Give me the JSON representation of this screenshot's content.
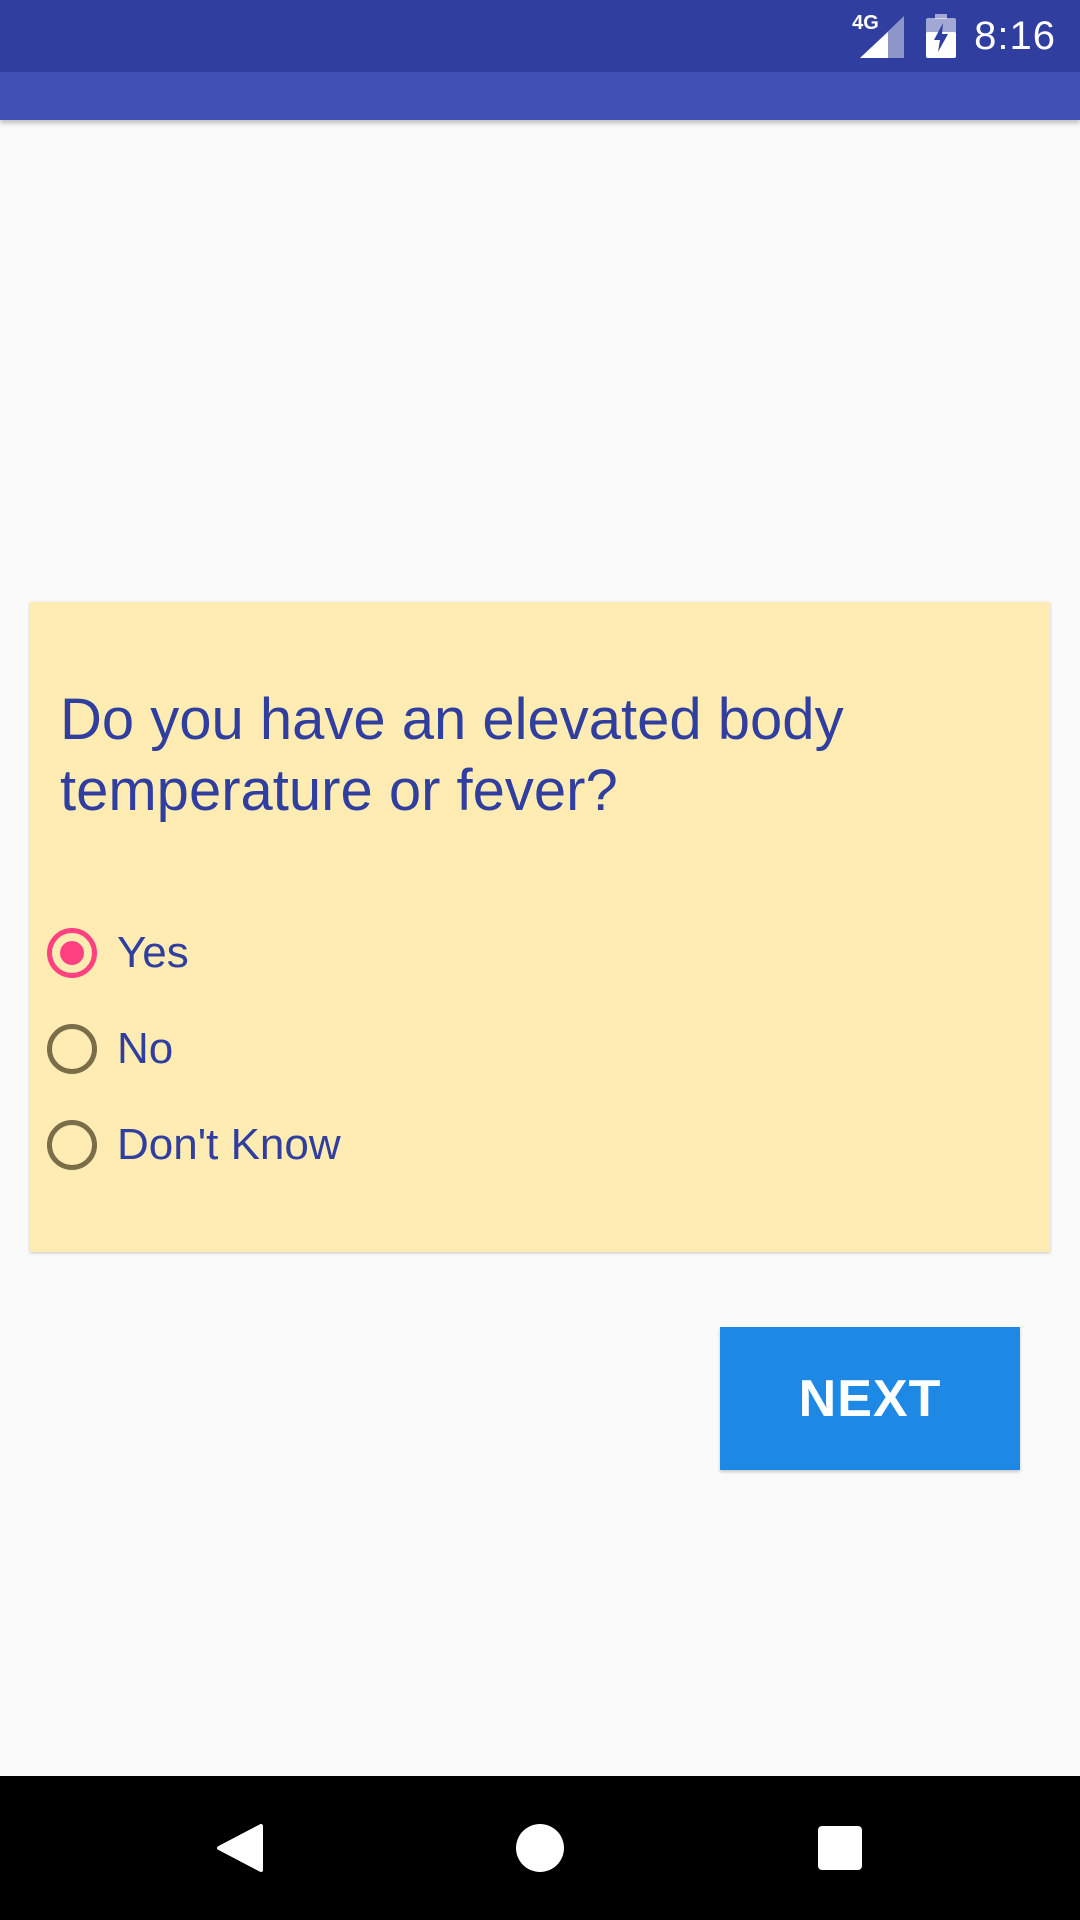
{
  "status_bar": {
    "network": "4G",
    "time": "8:16"
  },
  "question": {
    "text": "Do you have an elevated body temperature or fever?"
  },
  "options": [
    {
      "label": "Yes",
      "selected": true
    },
    {
      "label": "No",
      "selected": false
    },
    {
      "label": "Don't Know",
      "selected": false
    }
  ],
  "actions": {
    "next_label": "NEXT"
  },
  "colors": {
    "status_bar": "#303f9f",
    "app_bar": "#3f51b5",
    "card_background": "#ffecb3",
    "question_text": "#303f9f",
    "radio_selected": "#ff4081",
    "radio_unselected": "#7a6d4a",
    "next_button": "#1e88e5",
    "nav_bar": "#000000"
  },
  "icons": {
    "signal": "signal-icon",
    "battery": "battery-charging-icon",
    "back": "back-icon",
    "home": "home-icon",
    "recents": "recents-icon"
  }
}
